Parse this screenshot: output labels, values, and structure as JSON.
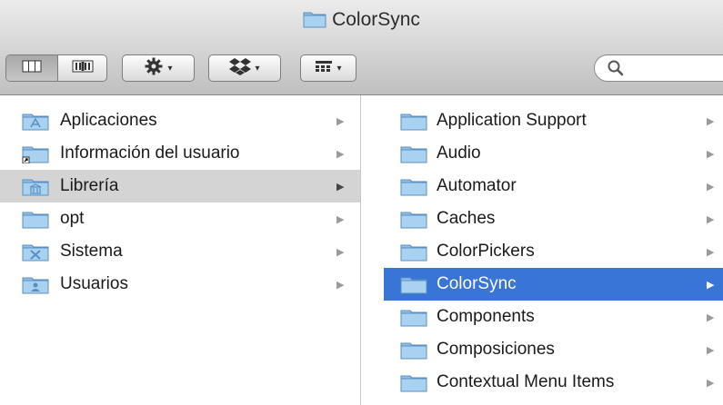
{
  "window": {
    "title": "ColorSync"
  },
  "toolbar": {
    "view_modes": [
      "column-view",
      "cover-flow-view"
    ],
    "action_caret": "▾",
    "dropbox_caret": "▾",
    "arrange_caret": "▾",
    "search": {
      "placeholder": "",
      "value": ""
    }
  },
  "sidebar_column": {
    "items": [
      {
        "label": "Aplicaciones",
        "icon": "applications-folder-icon",
        "arrow": "▶"
      },
      {
        "label": "Información del usuario",
        "icon": "alias-folder-icon",
        "arrow": "▶"
      },
      {
        "label": "Librería",
        "icon": "library-folder-icon",
        "arrow": "▶",
        "selected": true
      },
      {
        "label": "opt",
        "icon": "folder-icon",
        "arrow": "▶"
      },
      {
        "label": "Sistema",
        "icon": "system-folder-icon",
        "arrow": "▶"
      },
      {
        "label": "Usuarios",
        "icon": "users-folder-icon",
        "arrow": "▶"
      }
    ]
  },
  "library_column": {
    "items": [
      {
        "label": "Application Support",
        "arrow": "▶"
      },
      {
        "label": "Audio",
        "arrow": "▶"
      },
      {
        "label": "Automator",
        "arrow": "▶"
      },
      {
        "label": "Caches",
        "arrow": "▶"
      },
      {
        "label": "ColorPickers",
        "arrow": "▶"
      },
      {
        "label": "ColorSync",
        "arrow": "▶",
        "selected": true
      },
      {
        "label": "Components",
        "arrow": "▶"
      },
      {
        "label": "Composiciones",
        "arrow": "▶"
      },
      {
        "label": "Contextual Menu Items",
        "arrow": "▶"
      }
    ]
  },
  "colors": {
    "selection_blue": "#3875d7",
    "selection_gray": "#d4d4d4",
    "folder_blue": "#8fc1e8"
  }
}
